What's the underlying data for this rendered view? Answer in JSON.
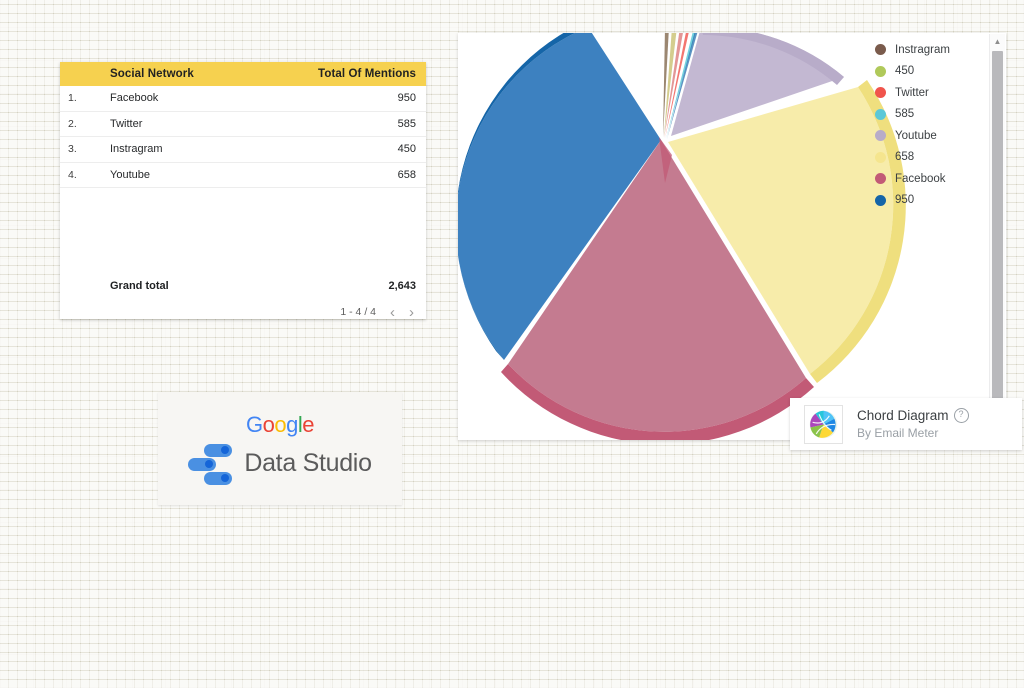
{
  "table": {
    "columns": {
      "index": "",
      "name": "Social Network",
      "value": "Total Of Mentions"
    },
    "rows": [
      {
        "index": "1.",
        "name": "Facebook",
        "value": "950"
      },
      {
        "index": "2.",
        "name": "Twitter",
        "value": "585"
      },
      {
        "index": "3.",
        "name": "Instragram",
        "value": "450"
      },
      {
        "index": "4.",
        "name": "Youtube",
        "value": "658"
      }
    ],
    "total_label": "Grand total",
    "total_value": "2,643",
    "pagination": {
      "range": "1 - 4 / 4",
      "prev": "‹",
      "next": "›"
    }
  },
  "logo_card": {
    "google": [
      {
        "ch": "G",
        "color": "#4285F4"
      },
      {
        "ch": "o",
        "color": "#EA4335"
      },
      {
        "ch": "o",
        "color": "#FBBC05"
      },
      {
        "ch": "g",
        "color": "#4285F4"
      },
      {
        "ch": "l",
        "color": "#34A853"
      },
      {
        "ch": "e",
        "color": "#EA4335"
      }
    ],
    "product": "Data Studio"
  },
  "chart_panel": {
    "legend": [
      {
        "label": "Instragram",
        "color": "#7a5b4c"
      },
      {
        "label": "450",
        "color": "#b0c95a"
      },
      {
        "label": "Twitter",
        "color": "#f0544c"
      },
      {
        "label": "585",
        "color": "#5cc8d8"
      },
      {
        "label": "Youtube",
        "color": "#b8acc9"
      },
      {
        "label": "658",
        "color": "#f5e58e"
      },
      {
        "label": "Facebook",
        "color": "#c25a76"
      },
      {
        "label": "950",
        "color": "#1565a8"
      }
    ],
    "scrollbar": {
      "up_arrow": "▲"
    }
  },
  "attribution": {
    "title": "Chord Diagram",
    "help": "?",
    "subtitle": "By Email Meter"
  },
  "chart_data": {
    "type": "pie",
    "title": "Chord Diagram",
    "categories": [
      "Facebook",
      "Twitter",
      "Instragram",
      "Youtube"
    ],
    "values": [
      950,
      585,
      450,
      658
    ],
    "total": 2643,
    "legend_position": "right",
    "grid": false,
    "node_colors": {
      "Instragram": "#7a5b4c",
      "450": "#b0c95a",
      "Twitter": "#f0544c",
      "585": "#5cc8d8",
      "Youtube": "#b8acc9",
      "658": "#f5e58e",
      "Facebook": "#c25a76",
      "950": "#1565a8"
    },
    "chords": [
      {
        "source": "Facebook",
        "target": "950",
        "value": 950
      },
      {
        "source": "Youtube",
        "target": "658",
        "value": 658
      },
      {
        "source": "Twitter",
        "target": "585",
        "value": 585
      },
      {
        "source": "Instragram",
        "target": "450",
        "value": 450
      }
    ]
  }
}
